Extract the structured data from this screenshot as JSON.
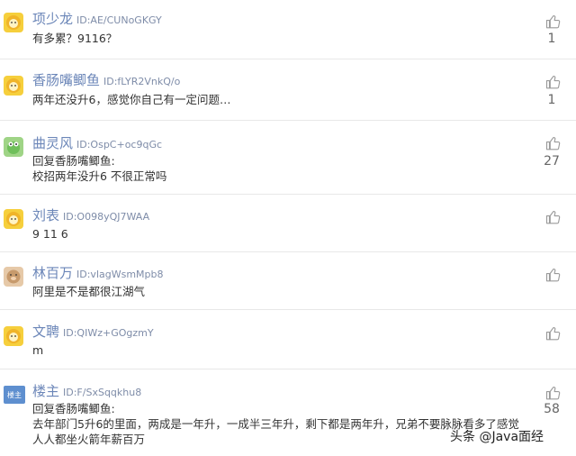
{
  "comments": [
    {
      "name": "项少龙",
      "uid": "ID:AE/CUNoGKGY",
      "lines": [
        "有多累？9116？"
      ],
      "likes": "1"
    },
    {
      "name": "香肠嘴鲫鱼",
      "uid": "ID:fLYR2VnkQ/o",
      "lines": [
        "两年还没升6，感觉你自己有一定问题…"
      ],
      "likes": "1"
    },
    {
      "name": "曲灵风",
      "uid": "ID:OspC+oc9qGc",
      "lines": [
        "回复香肠嘴鲫鱼:",
        "校招两年没升6 不很正常吗"
      ],
      "likes": "27"
    },
    {
      "name": "刘表",
      "uid": "ID:O098yQJ7WAA",
      "lines": [
        "9 11 6"
      ],
      "likes": ""
    },
    {
      "name": "林百万",
      "uid": "ID:vlagWsmMpb8",
      "lines": [
        "阿里是不是都很江湖气"
      ],
      "likes": ""
    },
    {
      "name": "文聘",
      "uid": "ID:QIWz+GOgzmY",
      "lines": [
        "m"
      ],
      "likes": ""
    },
    {
      "name": "楼主",
      "uid": "ID:F/SxSqqkhu8",
      "lines": [
        "回复香肠嘴鲫鱼:",
        "去年部门5升6的里面，两成是一年升，一成半三年升，剩下都是两年升，兄弟不要脉脉看多了感觉",
        "人人都坐火箭年薪百万"
      ],
      "likes": "58"
    }
  ],
  "op_avatar_label": "楼主",
  "watermark": "头条 @Java面经"
}
